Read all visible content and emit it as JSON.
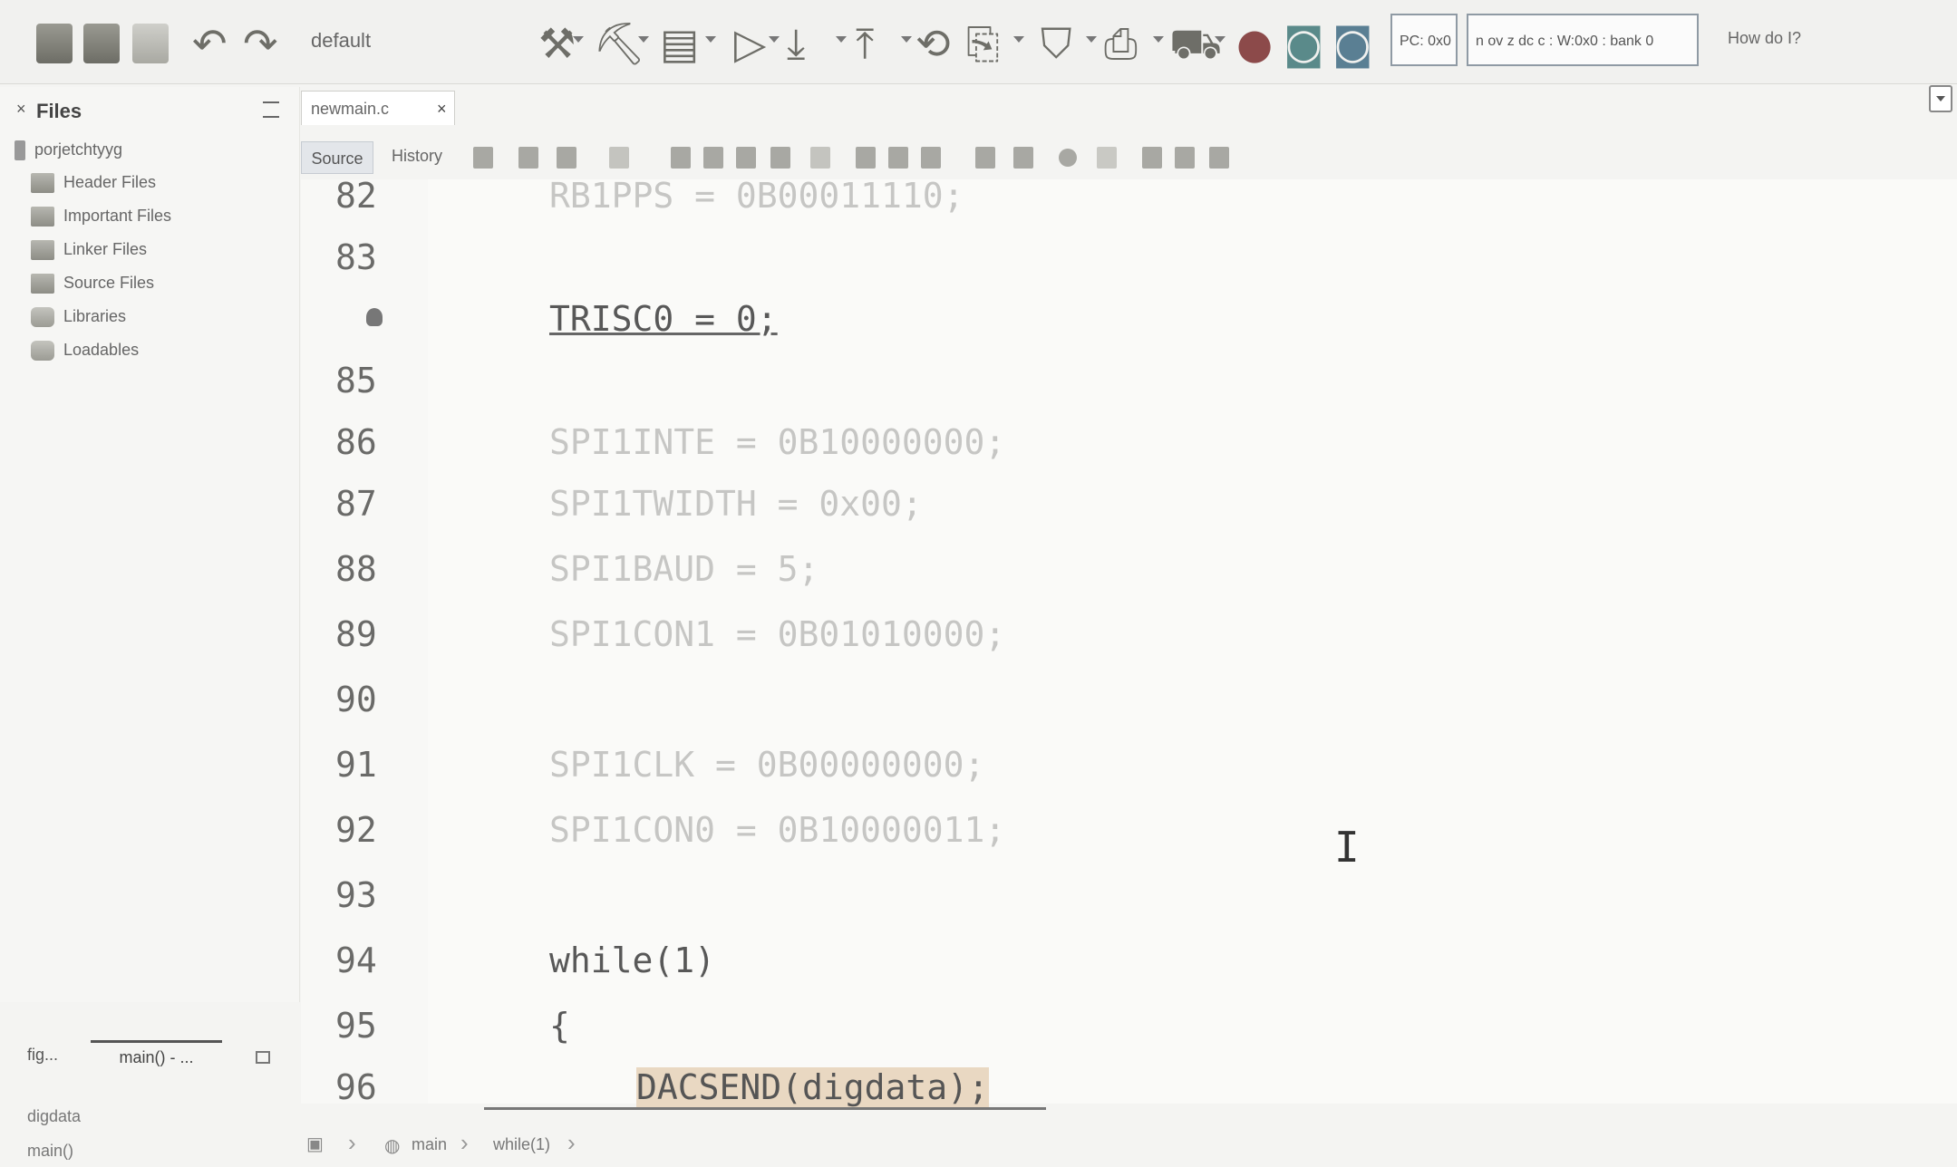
{
  "toolbar": {
    "config_selector": "default",
    "pc_status": "PC: 0x0",
    "register_status": "n ov z dc c : W:0x0 : bank 0",
    "how_do_i": "How do I?"
  },
  "files_panel": {
    "title": "Files",
    "project_name": "porjetchtyyg",
    "items": [
      {
        "label": "Header Files"
      },
      {
        "label": "Important Files"
      },
      {
        "label": "Linker Files"
      },
      {
        "label": "Source Files"
      },
      {
        "label": "Libraries"
      },
      {
        "label": "Loadables"
      }
    ]
  },
  "editor": {
    "file_tab": "newmain.c",
    "close_glyph": "×",
    "source_tab": "Source",
    "history_tab": "History",
    "lines": [
      {
        "num": "82",
        "text": "RB1PPS = 0B00011110;"
      },
      {
        "num": "83",
        "text": ""
      },
      {
        "num": "",
        "text": "TRISC0 = 0;"
      },
      {
        "num": "85",
        "text": ""
      },
      {
        "num": "86",
        "text": "SPI1INTE = 0B10000000;"
      },
      {
        "num": "87",
        "text": "SPI1TWIDTH = 0x00;"
      },
      {
        "num": "88",
        "text": "SPI1BAUD = 5;"
      },
      {
        "num": "89",
        "text": "SPI1CON1 = 0B01010000;"
      },
      {
        "num": "90",
        "text": ""
      },
      {
        "num": "91",
        "text": "SPI1CLK = 0B00000000;"
      },
      {
        "num": "92",
        "text": "SPI1CON0 = 0B10000011;"
      },
      {
        "num": "93",
        "text": ""
      },
      {
        "num": "94",
        "text": "while(1)"
      },
      {
        "num": "95",
        "text": "{"
      },
      {
        "num": "96",
        "text": "DACSEND(digdata);"
      }
    ]
  },
  "navigator": {
    "tab_left": "fig...",
    "tab_active": "main() - ...",
    "rows": [
      "digdata",
      "main()"
    ]
  },
  "breadcrumb": {
    "items": [
      "main",
      "while(1)"
    ]
  }
}
